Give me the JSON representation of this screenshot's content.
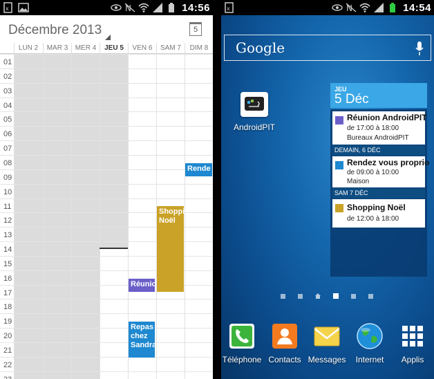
{
  "left": {
    "status": {
      "time": "14:56",
      "icons": [
        "mail-icon",
        "gallery-icon",
        "eye-icon",
        "mute-icon",
        "wifi-icon",
        "signal-icon",
        "battery-icon"
      ]
    },
    "header": {
      "title": "Décembre 2013",
      "today_day": "5"
    },
    "days": [
      {
        "label": "LUN 2",
        "today": false
      },
      {
        "label": "MAR 3",
        "today": false
      },
      {
        "label": "MER 4",
        "today": false
      },
      {
        "label": "JEU 5",
        "today": true
      },
      {
        "label": "VEN 6",
        "today": false
      },
      {
        "label": "SAM 7",
        "today": false
      },
      {
        "label": "DIM 8",
        "today": false
      }
    ],
    "hours": [
      "01",
      "02",
      "03",
      "04",
      "05",
      "06",
      "07",
      "08",
      "09",
      "10",
      "11",
      "12",
      "13",
      "14",
      "15",
      "16",
      "17",
      "18",
      "19",
      "20",
      "21",
      "22",
      "23"
    ],
    "events": [
      {
        "title": "Rende",
        "color": "#1e88d0"
      },
      {
        "title": "Shopping Noël",
        "color": "#c9a227"
      },
      {
        "title": "Réunio",
        "color": "#6a5fc8"
      },
      {
        "title": "Repas chez Sandra",
        "color": "#1e88d0"
      }
    ]
  },
  "right": {
    "status": {
      "time": "14:54",
      "icons": [
        "mail-icon",
        "eye-icon",
        "mute-icon",
        "wifi-icon",
        "signal-icon",
        "battery-icon"
      ]
    },
    "search": {
      "logo": "Google"
    },
    "shortcut": {
      "label": "AndroidPIT"
    },
    "widget": {
      "dow": "JEU",
      "date": "5 Déc",
      "events": [
        {
          "title": "Réunion AndroidPIT",
          "time": "de 17:00 à 18:00",
          "place": "Bureaux AndroidPIT",
          "color": "#6a5fc8"
        },
        {
          "title": "Rendez vous proprio",
          "time": "de 09:00 à 10:00",
          "place": "Maison",
          "color": "#1e88d0"
        },
        {
          "title": "Shopping Noël",
          "time": "de 12:00 à 18:00",
          "place": "",
          "color": "#c9a227"
        }
      ],
      "sections": [
        "DEMAIN, 6 DÉC",
        "SAM 7 DÉC"
      ]
    },
    "dock": [
      {
        "label": "Téléphone",
        "icon": "phone-icon"
      },
      {
        "label": "Contacts",
        "icon": "contacts-icon"
      },
      {
        "label": "Messages",
        "icon": "messages-icon"
      },
      {
        "label": "Internet",
        "icon": "internet-icon"
      },
      {
        "label": "Applis",
        "icon": "apps-icon"
      }
    ]
  }
}
